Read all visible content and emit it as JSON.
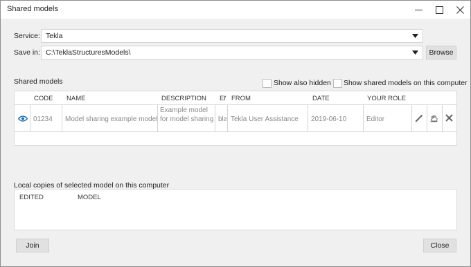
{
  "window": {
    "title": "Shared models"
  },
  "form": {
    "service_label": "Service:",
    "service_value": "Tekla",
    "savein_label": "Save in:",
    "savein_value": "C:\\TeklaStructuresModels\\",
    "browse_label": "Browse"
  },
  "shared": {
    "section_label": "Shared models",
    "show_hidden_label": "Show also hidden",
    "show_on_computer_label": "Show shared models on this computer",
    "columns": [
      "CODE",
      "NAME",
      "DESCRIPTION",
      "EN",
      "FROM",
      "DATE",
      "YOUR ROLE"
    ],
    "rows": [
      {
        "code": "01234",
        "name": "Model sharing example model",
        "description": "Example model for model sharing",
        "en": "bla",
        "from": "Tekla User Assistance",
        "date": "2019-06-10",
        "role": "Editor"
      }
    ],
    "row_icons": [
      "eye-icon",
      "pencil-icon",
      "hand-icon",
      "close-icon"
    ]
  },
  "local": {
    "section_label": "Local copies of selected model on this computer",
    "columns": [
      "EDITED",
      "MODEL"
    ]
  },
  "footer": {
    "join_label": "Join",
    "close_label": "Close"
  },
  "colors": {
    "accent": "#1a6fb3",
    "title_bg": "#ffffff",
    "dialog_bg": "#f0f0f0"
  }
}
